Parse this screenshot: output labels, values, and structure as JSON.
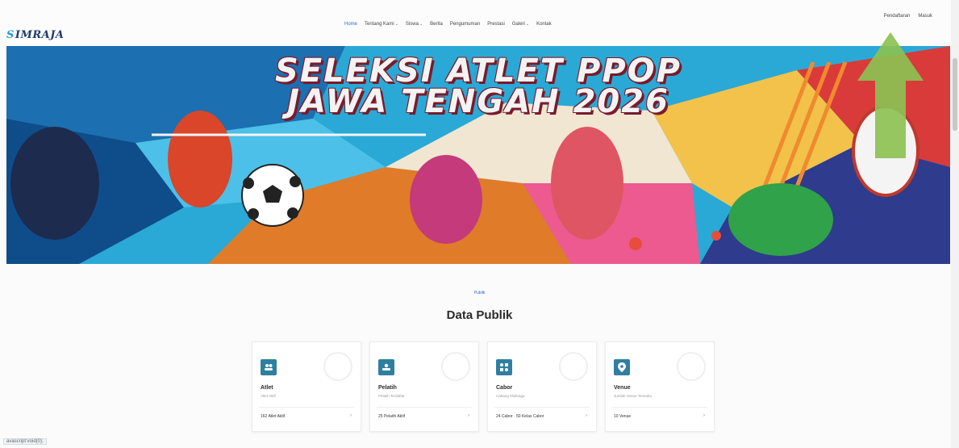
{
  "brand": {
    "logo_text": "IMRAJA",
    "logo_mark": "S"
  },
  "nav": {
    "items": [
      {
        "label": "Home",
        "dropdown": false,
        "active": true
      },
      {
        "label": "Tentang Kami",
        "dropdown": true,
        "active": false
      },
      {
        "label": "Siswa",
        "dropdown": true,
        "active": false
      },
      {
        "label": "Berita",
        "dropdown": false,
        "active": false
      },
      {
        "label": "Pengumuman",
        "dropdown": false,
        "active": false
      },
      {
        "label": "Prestasi",
        "dropdown": false,
        "active": false
      },
      {
        "label": "Galeri",
        "dropdown": true,
        "active": false
      },
      {
        "label": "Kontak",
        "dropdown": false,
        "active": false
      }
    ],
    "auth": {
      "register": "Pendaftaran",
      "login": "Masuk"
    }
  },
  "banner": {
    "line1": "SELEKSI ATLET PPOP",
    "line2": "JAWA TENGAH 2026"
  },
  "section": {
    "tag": "Publik",
    "title": "Data Publik"
  },
  "cards": [
    {
      "title": "Atlet",
      "subtitle": "Atlet Aktif",
      "value": "162 Atlet Aktif",
      "icon": "users-icon"
    },
    {
      "title": "Pelatih",
      "subtitle": "Pelatih Terdaftar",
      "value": "25 Pelatih Aktif",
      "icon": "coach-icon"
    },
    {
      "title": "Cabor",
      "subtitle": "Cabang Olahraga",
      "value": "24 Cabor · 50 Kelas Cabor",
      "icon": "sports-icon"
    },
    {
      "title": "Venue",
      "subtitle": "Jumlah Venue Tersedia",
      "value": "10 Venue",
      "icon": "location-pin-icon"
    }
  ],
  "status_bar": "avascript:void(0);",
  "colors": {
    "accent": "#1f6fd1",
    "card_icon_bg": "#2f7fa0",
    "arrow": "#8cc152"
  }
}
